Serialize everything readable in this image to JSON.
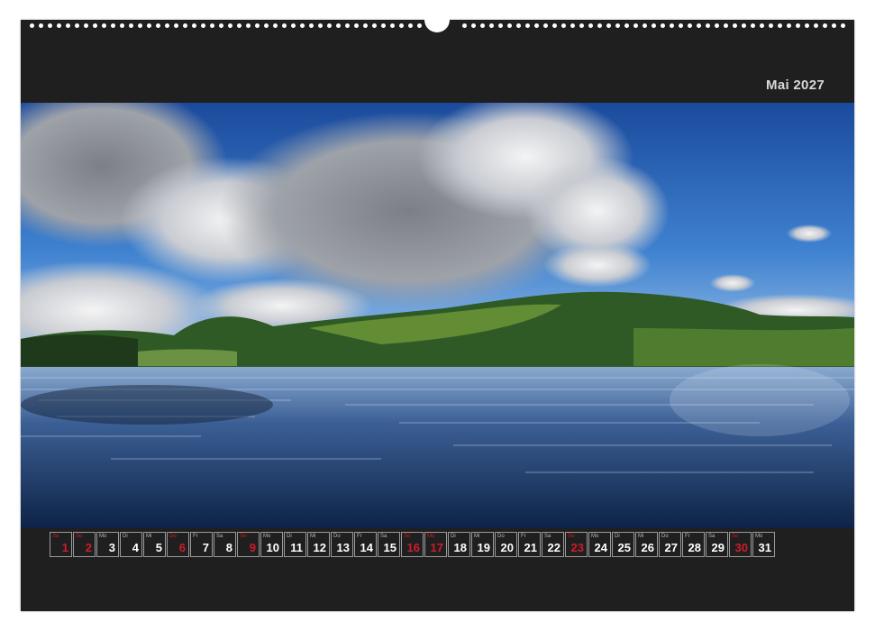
{
  "calendar": {
    "month_title": "Mai 2027",
    "days": [
      {
        "wd": "Sa",
        "num": "1",
        "red": true
      },
      {
        "wd": "So",
        "num": "2",
        "red": true
      },
      {
        "wd": "Mo",
        "num": "3",
        "red": false
      },
      {
        "wd": "Di",
        "num": "4",
        "red": false
      },
      {
        "wd": "Mi",
        "num": "5",
        "red": false
      },
      {
        "wd": "Do",
        "num": "6",
        "red": true
      },
      {
        "wd": "Fr",
        "num": "7",
        "red": false
      },
      {
        "wd": "Sa",
        "num": "8",
        "red": false
      },
      {
        "wd": "So",
        "num": "9",
        "red": true
      },
      {
        "wd": "Mo",
        "num": "10",
        "red": false
      },
      {
        "wd": "Di",
        "num": "11",
        "red": false
      },
      {
        "wd": "Mi",
        "num": "12",
        "red": false
      },
      {
        "wd": "Do",
        "num": "13",
        "red": false
      },
      {
        "wd": "Fr",
        "num": "14",
        "red": false
      },
      {
        "wd": "Sa",
        "num": "15",
        "red": false
      },
      {
        "wd": "So",
        "num": "16",
        "red": true
      },
      {
        "wd": "Mo",
        "num": "17",
        "red": true
      },
      {
        "wd": "Di",
        "num": "18",
        "red": false
      },
      {
        "wd": "Mi",
        "num": "19",
        "red": false
      },
      {
        "wd": "Do",
        "num": "20",
        "red": false
      },
      {
        "wd": "Fr",
        "num": "21",
        "red": false
      },
      {
        "wd": "Sa",
        "num": "22",
        "red": false
      },
      {
        "wd": "So",
        "num": "23",
        "red": true
      },
      {
        "wd": "Mo",
        "num": "24",
        "red": false
      },
      {
        "wd": "Di",
        "num": "25",
        "red": false
      },
      {
        "wd": "Mi",
        "num": "26",
        "red": false
      },
      {
        "wd": "Do",
        "num": "27",
        "red": false
      },
      {
        "wd": "Fr",
        "num": "28",
        "red": false
      },
      {
        "wd": "Sa",
        "num": "29",
        "red": false
      },
      {
        "wd": "So",
        "num": "30",
        "red": true
      },
      {
        "wd": "Mo",
        "num": "31",
        "red": false
      }
    ]
  },
  "colors": {
    "background": "#1f1f1f",
    "holiday_red": "#d01c2a",
    "title_gray": "#d9d9d9"
  },
  "photo": {
    "icon": "lake-landscape-photo"
  }
}
